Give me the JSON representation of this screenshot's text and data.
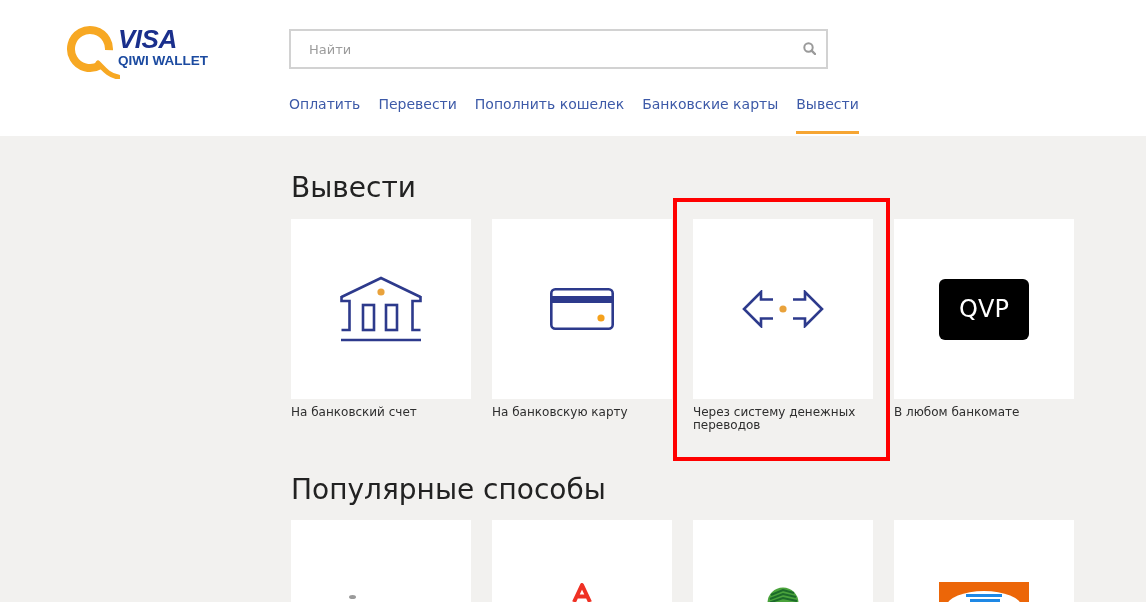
{
  "header": {
    "logo": {
      "brand": "VISA",
      "product": "QIWI WALLET"
    },
    "search": {
      "placeholder": "Найти"
    },
    "nav": [
      {
        "label": "Оплатить",
        "selected": false
      },
      {
        "label": "Перевести",
        "selected": false
      },
      {
        "label": "Пополнить кошелек",
        "selected": false
      },
      {
        "label": "Банковские карты",
        "selected": false
      },
      {
        "label": "Вывести",
        "selected": true
      }
    ]
  },
  "sections": [
    {
      "title": "Вывести",
      "cards": [
        {
          "kind": "bank",
          "label": "На банковский счет",
          "highlighted": false
        },
        {
          "kind": "card",
          "label": "На банковскую карту",
          "highlighted": false
        },
        {
          "kind": "transfer",
          "label": "Через систему денежных переводов",
          "highlighted": true
        },
        {
          "kind": "badge",
          "badge": "QVP",
          "label": "В любом банкомате",
          "highlighted": false
        }
      ]
    },
    {
      "title": "Популярные способы",
      "cards": [
        {
          "kind": "mark",
          "highlighted": false
        },
        {
          "kind": "letter",
          "highlighted": false
        },
        {
          "kind": "striped",
          "highlighted": false
        },
        {
          "kind": "tile",
          "highlighted": false
        }
      ]
    }
  ]
}
